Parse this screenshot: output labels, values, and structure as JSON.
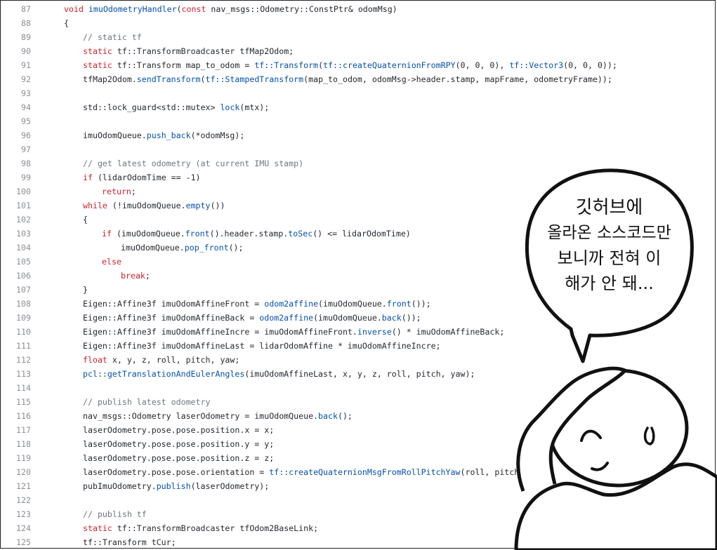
{
  "code_lines": [
    {
      "n": "87",
      "indent": 0,
      "t": [
        {
          "c": "kw",
          "s": "void "
        },
        {
          "c": "fn",
          "s": "imuOdometryHandler"
        },
        {
          "c": "",
          "s": "("
        },
        {
          "c": "kw",
          "s": "const "
        },
        {
          "c": "",
          "s": "nav_msgs::Odometry::ConstPtr& odomMsg)"
        }
      ]
    },
    {
      "n": "88",
      "indent": 0,
      "t": [
        {
          "c": "",
          "s": "{"
        }
      ]
    },
    {
      "n": "89",
      "indent": 1,
      "t": [
        {
          "c": "cm",
          "s": "// static tf"
        }
      ]
    },
    {
      "n": "90",
      "indent": 1,
      "t": [
        {
          "c": "kw",
          "s": "static "
        },
        {
          "c": "",
          "s": "tf::TransformBroadcaster tfMap2Odom;"
        }
      ]
    },
    {
      "n": "91",
      "indent": 1,
      "t": [
        {
          "c": "kw",
          "s": "static "
        },
        {
          "c": "",
          "s": "tf::Transform map_to_odom = "
        },
        {
          "c": "fn",
          "s": "tf::Transform"
        },
        {
          "c": "",
          "s": "("
        },
        {
          "c": "fn",
          "s": "tf::createQuaternionFromRPY"
        },
        {
          "c": "",
          "s": "(0, 0, 0), "
        },
        {
          "c": "fn",
          "s": "tf::Vector3"
        },
        {
          "c": "",
          "s": "(0, 0, 0));"
        }
      ]
    },
    {
      "n": "92",
      "indent": 1,
      "t": [
        {
          "c": "",
          "s": "tfMap2Odom."
        },
        {
          "c": "fn",
          "s": "sendTransform"
        },
        {
          "c": "",
          "s": "("
        },
        {
          "c": "fn",
          "s": "tf::StampedTransform"
        },
        {
          "c": "",
          "s": "(map_to_odom, odomMsg->header.stamp, mapFrame, odometryFrame));"
        }
      ]
    },
    {
      "n": "93",
      "indent": 0,
      "t": []
    },
    {
      "n": "94",
      "indent": 1,
      "t": [
        {
          "c": "",
          "s": "std::lock_guard<std::mutex> "
        },
        {
          "c": "fn",
          "s": "lock"
        },
        {
          "c": "",
          "s": "(mtx);"
        }
      ]
    },
    {
      "n": "95",
      "indent": 0,
      "t": []
    },
    {
      "n": "96",
      "indent": 1,
      "t": [
        {
          "c": "",
          "s": "imuOdomQueue."
        },
        {
          "c": "fn",
          "s": "push_back"
        },
        {
          "c": "",
          "s": "(*odomMsg);"
        }
      ]
    },
    {
      "n": "97",
      "indent": 0,
      "t": []
    },
    {
      "n": "98",
      "indent": 1,
      "t": [
        {
          "c": "cm",
          "s": "// get latest odometry (at current IMU stamp)"
        }
      ]
    },
    {
      "n": "99",
      "indent": 1,
      "t": [
        {
          "c": "kw",
          "s": "if "
        },
        {
          "c": "",
          "s": "(lidarOdomTime == -1)"
        }
      ]
    },
    {
      "n": "100",
      "indent": 2,
      "t": [
        {
          "c": "kw",
          "s": "return"
        },
        {
          "c": "",
          "s": ";"
        }
      ]
    },
    {
      "n": "101",
      "indent": 1,
      "t": [
        {
          "c": "kw",
          "s": "while "
        },
        {
          "c": "",
          "s": "(!imuOdomQueue."
        },
        {
          "c": "fn",
          "s": "empty"
        },
        {
          "c": "",
          "s": "())"
        }
      ]
    },
    {
      "n": "102",
      "indent": 1,
      "t": [
        {
          "c": "",
          "s": "{"
        }
      ]
    },
    {
      "n": "103",
      "indent": 2,
      "t": [
        {
          "c": "kw",
          "s": "if "
        },
        {
          "c": "",
          "s": "(imuOdomQueue."
        },
        {
          "c": "fn",
          "s": "front"
        },
        {
          "c": "",
          "s": "().header.stamp."
        },
        {
          "c": "fn",
          "s": "toSec"
        },
        {
          "c": "",
          "s": "() <= lidarOdomTime)"
        }
      ]
    },
    {
      "n": "104",
      "indent": 3,
      "t": [
        {
          "c": "",
          "s": "imuOdomQueue."
        },
        {
          "c": "fn",
          "s": "pop_front"
        },
        {
          "c": "",
          "s": "();"
        }
      ]
    },
    {
      "n": "105",
      "indent": 2,
      "t": [
        {
          "c": "kw",
          "s": "else"
        }
      ]
    },
    {
      "n": "106",
      "indent": 3,
      "t": [
        {
          "c": "kw",
          "s": "break"
        },
        {
          "c": "",
          "s": ";"
        }
      ]
    },
    {
      "n": "107",
      "indent": 1,
      "t": [
        {
          "c": "",
          "s": "}"
        }
      ]
    },
    {
      "n": "108",
      "indent": 1,
      "t": [
        {
          "c": "",
          "s": "Eigen::Affine3f imuOdomAffineFront = "
        },
        {
          "c": "fn",
          "s": "odom2affine"
        },
        {
          "c": "",
          "s": "(imuOdomQueue."
        },
        {
          "c": "fn",
          "s": "front"
        },
        {
          "c": "",
          "s": "());"
        }
      ]
    },
    {
      "n": "109",
      "indent": 1,
      "t": [
        {
          "c": "",
          "s": "Eigen::Affine3f imuOdomAffineBack = "
        },
        {
          "c": "fn",
          "s": "odom2affine"
        },
        {
          "c": "",
          "s": "(imuOdomQueue."
        },
        {
          "c": "fn",
          "s": "back"
        },
        {
          "c": "",
          "s": "());"
        }
      ]
    },
    {
      "n": "110",
      "indent": 1,
      "t": [
        {
          "c": "",
          "s": "Eigen::Affine3f imuOdomAffineIncre = imuOdomAffineFront."
        },
        {
          "c": "fn",
          "s": "inverse"
        },
        {
          "c": "",
          "s": "() * imuOdomAffineBack;"
        }
      ]
    },
    {
      "n": "111",
      "indent": 1,
      "t": [
        {
          "c": "",
          "s": "Eigen::Affine3f imuOdomAffineLast = lidarOdomAffine * imuOdomAffineIncre;"
        }
      ]
    },
    {
      "n": "112",
      "indent": 1,
      "t": [
        {
          "c": "kw",
          "s": "float "
        },
        {
          "c": "",
          "s": "x, y, z, roll, pitch, yaw;"
        }
      ]
    },
    {
      "n": "113",
      "indent": 1,
      "t": [
        {
          "c": "fn",
          "s": "pcl::getTranslationAndEulerAngles"
        },
        {
          "c": "",
          "s": "(imuOdomAffineLast, x, y, z, roll, pitch, yaw);"
        }
      ]
    },
    {
      "n": "114",
      "indent": 0,
      "t": []
    },
    {
      "n": "115",
      "indent": 1,
      "t": [
        {
          "c": "cm",
          "s": "// publish latest odometry"
        }
      ]
    },
    {
      "n": "116",
      "indent": 1,
      "t": [
        {
          "c": "",
          "s": "nav_msgs::Odometry laserOdometry = imuOdomQueue."
        },
        {
          "c": "fn",
          "s": "back"
        },
        {
          "c": "",
          "s": "();"
        }
      ]
    },
    {
      "n": "117",
      "indent": 1,
      "t": [
        {
          "c": "",
          "s": "laserOdometry.pose.pose.position.x = x;"
        }
      ]
    },
    {
      "n": "118",
      "indent": 1,
      "t": [
        {
          "c": "",
          "s": "laserOdometry.pose.pose.position.y = y;"
        }
      ]
    },
    {
      "n": "119",
      "indent": 1,
      "t": [
        {
          "c": "",
          "s": "laserOdometry.pose.pose.position.z = z;"
        }
      ]
    },
    {
      "n": "120",
      "indent": 1,
      "t": [
        {
          "c": "",
          "s": "laserOdometry.pose.pose.orientation = "
        },
        {
          "c": "fn",
          "s": "tf::createQuaternionMsgFromRollPitchYaw"
        },
        {
          "c": "",
          "s": "(roll, pitch, yaw"
        }
      ]
    },
    {
      "n": "121",
      "indent": 1,
      "t": [
        {
          "c": "",
          "s": "pubImuOdometry."
        },
        {
          "c": "fn",
          "s": "publish"
        },
        {
          "c": "",
          "s": "(laserOdometry);"
        }
      ]
    },
    {
      "n": "122",
      "indent": 0,
      "t": []
    },
    {
      "n": "123",
      "indent": 1,
      "t": [
        {
          "c": "cm",
          "s": "// publish tf"
        }
      ]
    },
    {
      "n": "124",
      "indent": 1,
      "t": [
        {
          "c": "kw",
          "s": "static "
        },
        {
          "c": "",
          "s": "tf::TransformBroadcaster tfOdom2BaseLink;"
        }
      ]
    },
    {
      "n": "125",
      "indent": 1,
      "t": [
        {
          "c": "",
          "s": "tf::Transform tCur;"
        }
      ]
    }
  ],
  "speech_bubble": {
    "line1": "깃허브에",
    "line2": "올라온 소스코드만",
    "line3": "보니까 전혀 이",
    "line4": "해가 안 돼..."
  },
  "colors": {
    "keyword": "#cf222e",
    "function": "#0550ae",
    "comment": "#6e7781",
    "text": "#24292f",
    "line_number": "#8b8f94"
  }
}
